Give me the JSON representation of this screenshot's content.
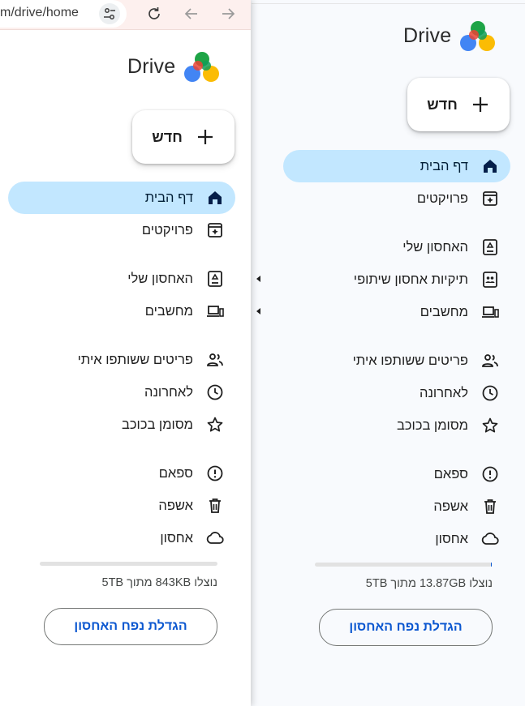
{
  "browser": {
    "url_text": "m/drive/home",
    "icons": [
      "tune-icon",
      "reload-icon",
      "back-icon",
      "forward-icon"
    ]
  },
  "left_panel": {
    "app_name": "Drive",
    "new_button_label": "חדש",
    "nav": [
      {
        "label": "דף הבית",
        "icon": "home-icon",
        "active": true
      },
      {
        "label": "פרויקטים",
        "icon": "projects-icon"
      },
      {
        "label": "האחסון שלי",
        "icon": "my-drive-icon",
        "expandable": true
      },
      {
        "label": "מחשבים",
        "icon": "computers-icon",
        "expandable": true
      },
      {
        "label": "פריטים ששותפו איתי",
        "icon": "shared-people-icon"
      },
      {
        "label": "לאחרונה",
        "icon": "clock-icon"
      },
      {
        "label": "מסומן בכוכב",
        "icon": "star-icon"
      },
      {
        "label": "ספאם",
        "icon": "spam-icon"
      },
      {
        "label": "אשפה",
        "icon": "trash-icon"
      },
      {
        "label": "אחסון",
        "icon": "cloud-icon"
      }
    ],
    "storage_text": "נוצלו 843KB מתוך 5TB",
    "storage_used_fraction": 0.0,
    "upgrade_label": "הגדלת נפח האחסון"
  },
  "right_panel": {
    "app_name": "Drive",
    "new_button_label": "חדש",
    "nav": [
      {
        "label": "דף הבית",
        "icon": "home-icon",
        "active": true
      },
      {
        "label": "פרויקטים",
        "icon": "projects-icon"
      },
      {
        "label": "האחסון שלי",
        "icon": "my-drive-icon",
        "expandable": true
      },
      {
        "label": "תיקיות אחסון שיתופי",
        "icon": "shared-drives-icon",
        "expandable": true
      },
      {
        "label": "מחשבים",
        "icon": "computers-icon",
        "expandable": true
      },
      {
        "label": "פריטים ששותפו איתי",
        "icon": "shared-people-icon"
      },
      {
        "label": "לאחרונה",
        "icon": "clock-icon"
      },
      {
        "label": "מסומן בכוכב",
        "icon": "star-icon"
      },
      {
        "label": "ספאם",
        "icon": "spam-icon"
      },
      {
        "label": "אשפה",
        "icon": "trash-icon"
      },
      {
        "label": "אחסון",
        "icon": "cloud-icon"
      }
    ],
    "storage_text": "נוצלו 13.87GB מתוך 5TB",
    "storage_used_fraction": 0.003,
    "upgrade_label": "הגדלת נפח האחסון"
  },
  "colors": {
    "active_bg": "#c2e7ff",
    "link_blue": "#0b57d0",
    "home_icon": "#041e49"
  }
}
